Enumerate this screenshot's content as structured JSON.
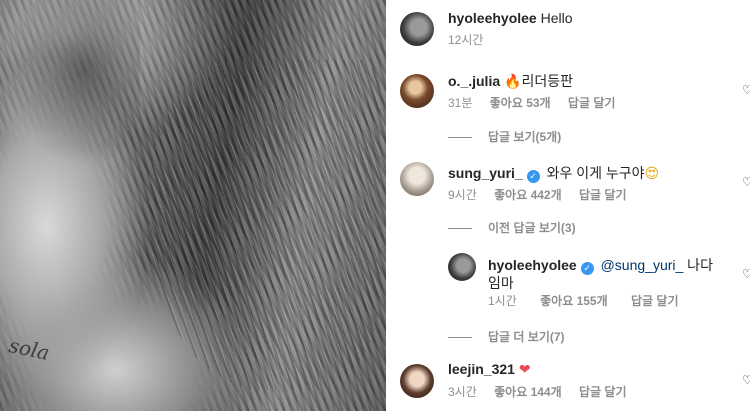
{
  "photo": {
    "alt_icon": "portrait-photo"
  },
  "caption": {
    "username": "hyoleehyolee",
    "text": "Hello",
    "time": "12시간"
  },
  "comments": [
    {
      "username": "o._.julia",
      "emoji": "🔥",
      "text": "리더등판",
      "time": "31분",
      "likes": "좋아요 53개",
      "reply": "답글 달기",
      "view_replies": "답글 보기(5개)"
    },
    {
      "username": "sung_yuri_",
      "verified": true,
      "text": "와우 이게 누구야",
      "emoji": "😍",
      "time": "9시간",
      "likes": "좋아요 442개",
      "reply": "답글 달기",
      "view_prev": "이전 답글 보기(3)"
    },
    {
      "username": "leejin_321",
      "emoji": "❤",
      "time": "3시간",
      "likes": "좋아요 144개",
      "reply": "답글 달기"
    }
  ],
  "reply": {
    "username": "hyoleehyolee",
    "verified": true,
    "mention": "@sung_yuri_",
    "text_line1": " 나다",
    "text_line2": "임마",
    "time": "1시간",
    "likes": "좋아요 155개",
    "reply": "답글 달기",
    "view_more": "답글 더 보기(7)"
  },
  "tattoo_text": "sola",
  "verified_mark": "✓",
  "heart_icon": "♡",
  "colors": {
    "verified": "#3897f0",
    "meta": "#8e8e8e",
    "text": "#262626",
    "mention": "#00376b"
  }
}
